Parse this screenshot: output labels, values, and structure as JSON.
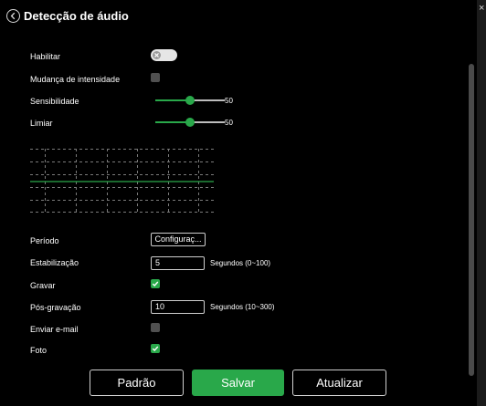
{
  "dialog": {
    "title": "Detecção de áudio",
    "close_glyph": "×"
  },
  "colors": {
    "accent": "#29a84a",
    "background": "#000000",
    "toggle_on": "#e6e6e6",
    "checkbox_off": "#505050"
  },
  "form": {
    "enable": {
      "label": "Habilitar",
      "state": "off"
    },
    "intensity_change": {
      "label": "Mudança de intensidade",
      "checked": false
    },
    "sensitivity": {
      "label": "Sensibilidade",
      "value": "50",
      "min": 0,
      "max": 100
    },
    "threshold": {
      "label": "Limiar",
      "value": "50",
      "min": 0,
      "max": 100
    },
    "period": {
      "label": "Período",
      "button_label": "Configuraç..."
    },
    "stabilization": {
      "label": "Estabilização",
      "value": "5",
      "unit": "Segundos (0~100)"
    },
    "record": {
      "label": "Gravar",
      "checked": true
    },
    "post_record": {
      "label": "Pós-gravação",
      "value": "10",
      "unit": "Segundos (10~300)"
    },
    "send_email": {
      "label": "Enviar e-mail",
      "checked": false
    },
    "photo": {
      "label": "Foto",
      "checked": true
    }
  },
  "footer": {
    "default_label": "Padrão",
    "save_label": "Salvar",
    "refresh_label": "Atualizar"
  },
  "icons": {
    "back": "chevron-left-icon",
    "toggle": "x-icon",
    "check": "check-icon",
    "close": "close-icon"
  }
}
